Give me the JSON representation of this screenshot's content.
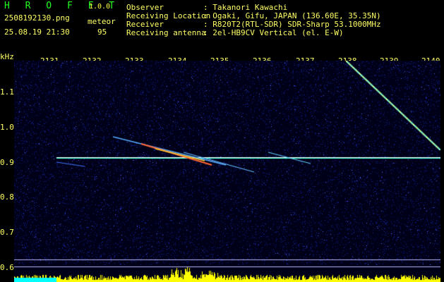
{
  "app": {
    "logo": "H R O F F T",
    "version": "1.0.0"
  },
  "file": {
    "name": "2508192130.png",
    "datetime": "25.08.19 21:30"
  },
  "detect": {
    "label": "meteor",
    "count": "95"
  },
  "info": {
    "observer_label": "Observer",
    "observer_value": ": Takanori Kawachi",
    "location_label": "Receiving Location",
    "location_value": ": Ogaki, Gifu, JAPAN (136.60E, 35.35N)",
    "receiver_label": "Receiver",
    "receiver_value": ": R820T2(RTL-SDR) SDR-Sharp 53.1000MHz",
    "antenna_label": "Receiving antenna",
    "antenna_value": ": 2el-HB9CV Vertical (el. E-W)"
  },
  "axis": {
    "y_unit": "kHz",
    "x_ticks": [
      "2131",
      "2132",
      "2133",
      "2134",
      "2135",
      "2136",
      "2137",
      "2138",
      "2139",
      "2140"
    ],
    "y_ticks": [
      "1.1",
      "1.0",
      "0.9",
      "0.8",
      "0.7",
      "0.6"
    ]
  },
  "colors": {
    "background": "#000000",
    "noise": "#1a2aa0",
    "carrier": "#33ffcc",
    "axis_text": "#ffff66",
    "bars": "#ffff00",
    "cyan_band": "#00ffff"
  }
}
